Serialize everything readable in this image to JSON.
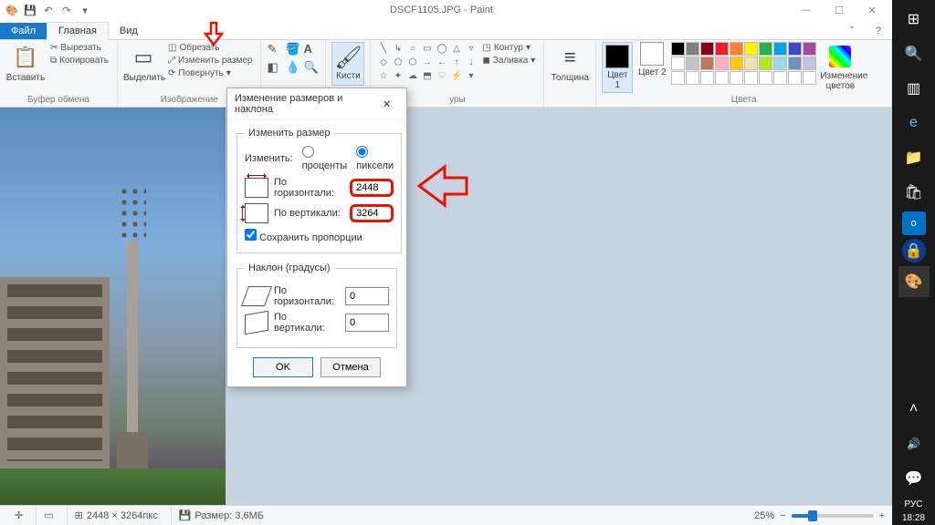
{
  "title": "DSCF1105.JPG - Paint",
  "tabs": {
    "file": "Файл",
    "home": "Главная",
    "view": "Вид"
  },
  "ribbon": {
    "clipboard": {
      "paste": "Вставить",
      "cut": "Вырезать",
      "copy": "Копировать",
      "label": "Буфер обмена"
    },
    "image": {
      "select": "Выделить",
      "crop": "Обрезать",
      "resize": "Изменить размер",
      "rotate": "Повернуть",
      "label": "Изображение"
    },
    "tools_label": "",
    "brush": "Кисти",
    "shapes": {
      "outline": "Контур",
      "fill": "Заливка",
      "label": "уры"
    },
    "thickness": "Толщина",
    "color1": "Цвет 1",
    "color2": "Цвет 2",
    "colors_label": "Цвета",
    "editcolors": "Изменение цветов"
  },
  "dialog": {
    "title": "Изменение размеров и наклона",
    "resize_legend": "Изменить размер",
    "by_label": "Изменить:",
    "percent": "проценты",
    "pixels": "пиксели",
    "horizontal": "По горизонтали:",
    "vertical": "По вертикали:",
    "h_value": "2448",
    "v_value": "3264",
    "keep_aspect": "Сохранить пропорции",
    "skew_legend": "Наклон (градусы)",
    "skew_h": "По горизонтали:",
    "skew_v": "По вертикали:",
    "skew_h_value": "0",
    "skew_v_value": "0",
    "ok": "OK",
    "cancel": "Отмена"
  },
  "status": {
    "dims": "2448 × 3264пкс",
    "size_label": "Размер: 3,6МБ",
    "zoom": "25%"
  },
  "taskbar": {
    "lang": "РУС",
    "time": "18:28"
  },
  "palette": [
    "#000",
    "#7f7f7f",
    "#880015",
    "#ed1c24",
    "#ff7f27",
    "#fff200",
    "#22b14c",
    "#00a2e8",
    "#3f48cc",
    "#a349a4",
    "#fff",
    "#c3c3c3",
    "#b97a57",
    "#ffaec9",
    "#ffc90e",
    "#efe4b0",
    "#b5e61d",
    "#99d9ea",
    "#7092be",
    "#c8bfe7",
    "#fff",
    "#fff",
    "#fff",
    "#fff",
    "#fff",
    "#fff",
    "#fff",
    "#fff",
    "#fff",
    "#fff"
  ]
}
